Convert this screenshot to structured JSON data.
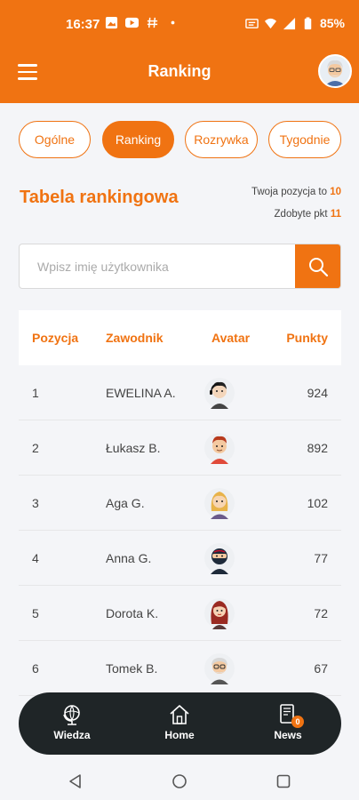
{
  "status_bar": {
    "time": "16:37",
    "battery": "85%",
    "icons": [
      "image-icon",
      "youtube-icon",
      "hashtag-icon",
      "dot-icon",
      "cast-icon",
      "wifi-icon",
      "signal-icon",
      "battery-icon"
    ]
  },
  "header": {
    "title": "Ranking",
    "menu_icon": "hamburger-menu-icon",
    "avatar_icon": "user-avatar-icon"
  },
  "tabs": [
    {
      "label": "Ogólne",
      "active": false
    },
    {
      "label": "Ranking",
      "active": true
    },
    {
      "label": "Rozrywka",
      "active": false
    },
    {
      "label": "Tygodnie",
      "active": false
    }
  ],
  "section": {
    "title": "Tabela rankingowa",
    "position_label": "Twoja pozycja to",
    "position_value": "10",
    "points_label": "Zdobyte pkt",
    "points_value": "11"
  },
  "search": {
    "placeholder": "Wpisz imię użytkownika",
    "value": "",
    "icon": "search-icon"
  },
  "table": {
    "headers": [
      "Pozycja",
      "Zawodnik",
      "Avatar",
      "Punkty"
    ],
    "rows": [
      {
        "position": "1",
        "name": "EWELINA A.",
        "avatar": "girl-headset-avatar-icon",
        "points": "924"
      },
      {
        "position": "2",
        "name": "Łukasz B.",
        "avatar": "red-hair-boy-avatar-icon",
        "points": "892"
      },
      {
        "position": "3",
        "name": "Aga G.",
        "avatar": "blonde-girl-avatar-icon",
        "points": "102"
      },
      {
        "position": "4",
        "name": "Anna G.",
        "avatar": "ninja-avatar-icon",
        "points": "77"
      },
      {
        "position": "5",
        "name": "Dorota K.",
        "avatar": "red-hair-woman-avatar-icon",
        "points": "72"
      },
      {
        "position": "6",
        "name": "Tomek B.",
        "avatar": "old-man-glasses-avatar-icon",
        "points": "67"
      }
    ]
  },
  "bottom_nav": {
    "items": [
      {
        "label": "Wiedza",
        "icon": "globe-icon"
      },
      {
        "label": "Home",
        "icon": "home-icon"
      },
      {
        "label": "News",
        "icon": "news-icon",
        "badge": "0"
      }
    ]
  },
  "colors": {
    "accent": "#f07312",
    "nav_bg": "#1f2527",
    "page_bg": "#f4f5f8"
  }
}
